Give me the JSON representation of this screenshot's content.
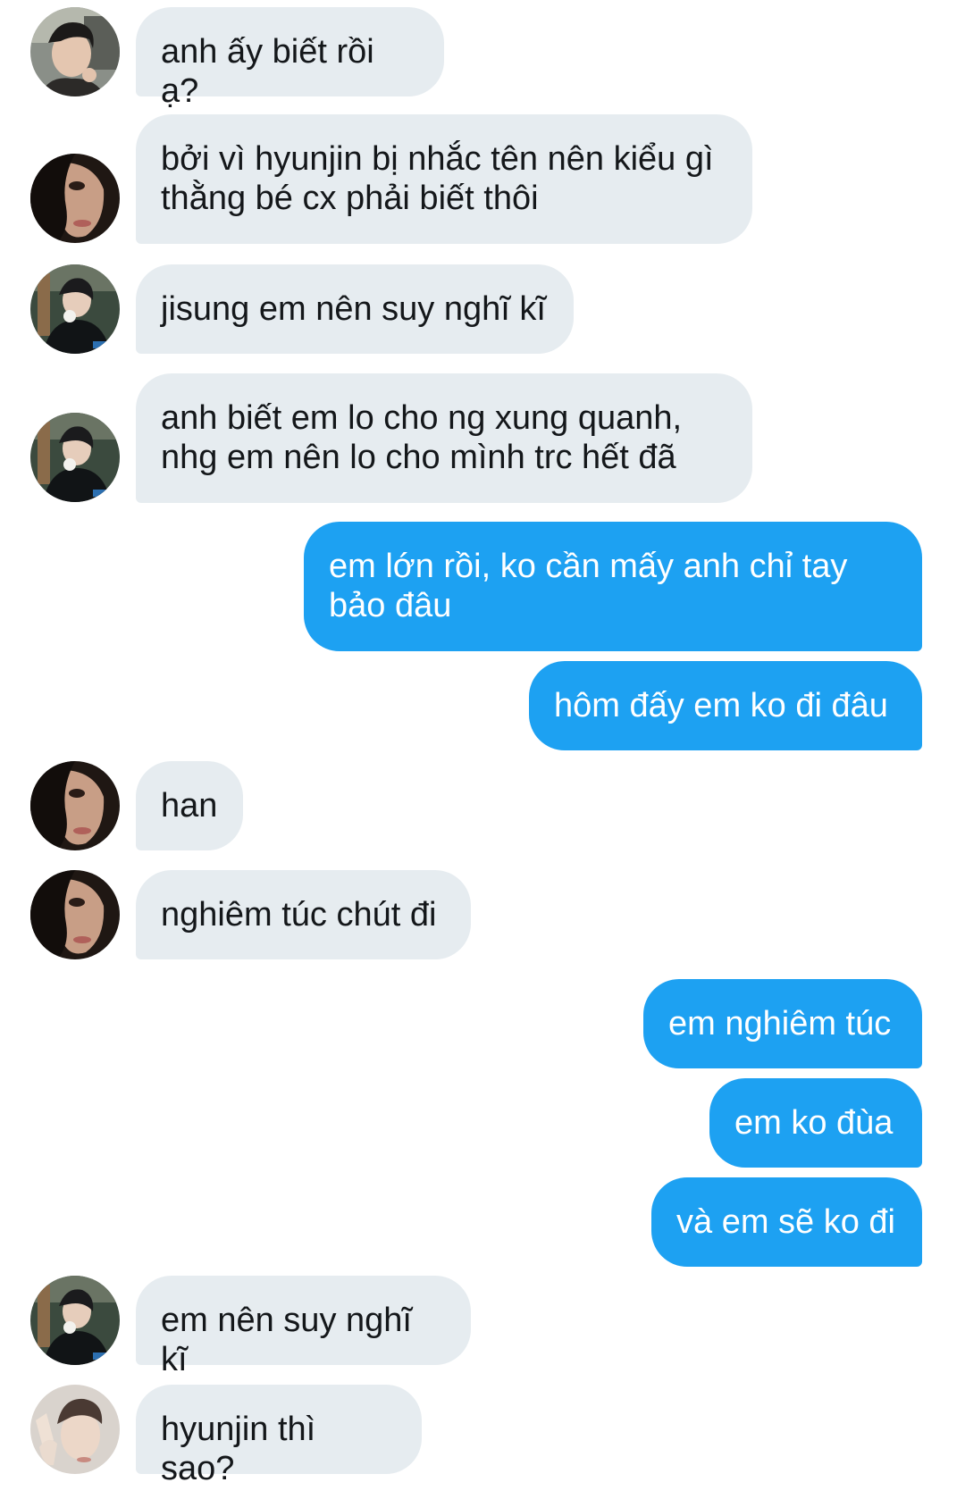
{
  "conversation": {
    "messages": [
      {
        "sender": "A",
        "text": "anh ấy biết rồi ạ?"
      },
      {
        "sender": "B",
        "text": "bởi vì hyunjin bị nhắc tên nên kiểu gì\nthằng bé cx phải biết thôi"
      },
      {
        "sender": "C",
        "text": "jisung em nên suy nghĩ kĩ"
      },
      {
        "sender": "C",
        "text": "anh biết em lo cho ng xung quanh,\nnhg em nên lo cho mình trc hết đã"
      },
      {
        "sender": "me",
        "text": "em lớn rồi, ko cần mấy anh chỉ tay\nbảo đâu"
      },
      {
        "sender": "me",
        "text": "hôm đấy em ko đi đâu"
      },
      {
        "sender": "B",
        "text": "han"
      },
      {
        "sender": "B",
        "text": "nghiêm túc chút đi"
      },
      {
        "sender": "me",
        "text": "em nghiêm túc"
      },
      {
        "sender": "me",
        "text": "em ko đùa"
      },
      {
        "sender": "me",
        "text": "và em sẽ ko đi"
      },
      {
        "sender": "C",
        "text": "em nên suy nghĩ kĩ"
      },
      {
        "sender": "D",
        "text": "hyunjin thì sao?"
      }
    ]
  },
  "colors": {
    "incoming_bubble": "#e6ecf0",
    "outgoing_bubble": "#1da1f2",
    "incoming_text": "#14171a",
    "outgoing_text": "#ffffff"
  },
  "icons": {
    "avatar_A": "avatar-photo-icon",
    "avatar_B": "avatar-photo-icon",
    "avatar_C": "avatar-photo-icon",
    "avatar_D": "avatar-photo-icon"
  }
}
